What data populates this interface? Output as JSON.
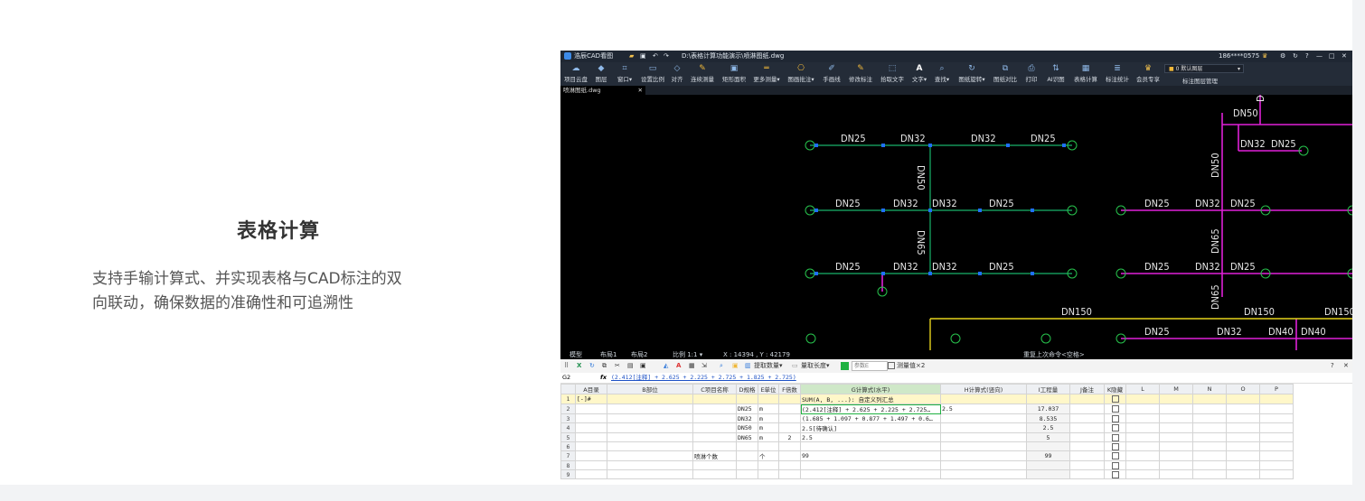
{
  "feature": {
    "title": "表格计算",
    "desc_line1": "支持手输计算式、并实现表格与CAD标注的双",
    "desc_line2": "向联动，确保数据的准确性和可追溯性"
  },
  "app": {
    "title": "浩辰CAD看图",
    "path": "D:\\表格计算功能演示\\喷淋图纸.dwg",
    "user": "186****0575",
    "window_controls": [
      "?",
      "—",
      "□",
      "✕"
    ],
    "ribbon": [
      {
        "icon": "cloud-icon",
        "label": "项目云盘"
      },
      {
        "icon": "layers-icon",
        "label": "图层"
      },
      {
        "icon": "window-icon",
        "label": "窗口▾"
      },
      {
        "icon": "scale-icon",
        "label": "设置比例"
      },
      {
        "icon": "align-icon",
        "label": "对齐"
      },
      {
        "icon": "measure-icon",
        "label": "连续测量"
      },
      {
        "icon": "area-icon",
        "label": "矩形面积"
      },
      {
        "icon": "more-measure-icon",
        "label": "更多测量▾"
      },
      {
        "icon": "annotate-icon",
        "label": "图画批注▾"
      },
      {
        "icon": "pen-icon",
        "label": "手画线"
      },
      {
        "icon": "edit-mark-icon",
        "label": "修改标注"
      },
      {
        "icon": "pick-text-icon",
        "label": "拾取文字"
      },
      {
        "icon": "text-icon",
        "label": "文字▾"
      },
      {
        "icon": "find-icon",
        "label": "查找▾"
      },
      {
        "icon": "rotate-icon",
        "label": "图纸旋转▾"
      },
      {
        "icon": "compare-icon",
        "label": "图纸对比"
      },
      {
        "icon": "print-icon",
        "label": "打印"
      },
      {
        "icon": "ai-icon",
        "label": "AI识图"
      },
      {
        "icon": "table-calc-icon",
        "label": "表格计算"
      },
      {
        "icon": "stats-icon",
        "label": "标注统计"
      },
      {
        "icon": "vip-icon",
        "label": "会员专享"
      }
    ],
    "layer_select": "0 默认图层",
    "layer_manage": "标注图层管理",
    "doc_tab": "喷淋图纸.dwg",
    "status": {
      "model_tab": "模型",
      "layout1": "布局1",
      "layout2": "布局2",
      "scale": "比例 1:1 ▾",
      "coords": "X : 14394 , Y : 42179",
      "command": "重复上次命令<空格>"
    }
  },
  "drawing": {
    "left": {
      "row1": [
        "DN25",
        "DN32",
        "DN32",
        "DN25"
      ],
      "vert1": "DN50",
      "row2": [
        "DN25",
        "DN32",
        "DN32",
        "DN25"
      ],
      "vert2": "DN65",
      "row3": [
        "DN25",
        "DN32",
        "DN32",
        "DN25"
      ]
    },
    "right": {
      "top": [
        "DN50",
        "DN32",
        "DN32",
        "DN25"
      ],
      "vert_top": "DN50",
      "row2": [
        "DN25",
        "DN32",
        "DN25"
      ],
      "vert_mid": "DN65",
      "row3": [
        "DN25",
        "DN32",
        "DN25"
      ],
      "vert_low": "DN65",
      "main_left": "DN150",
      "main_right": [
        "DN150",
        "DN150"
      ],
      "row4": [
        "DN25",
        "DN32",
        "DN40",
        "DN40"
      ]
    },
    "colors": {
      "green_pipe": "#18b36b",
      "magenta_pipe": "#e020d8",
      "yellow_pipe": "#e6d21c",
      "node": "#1f6fff",
      "sprinkler": "#27c24c",
      "label": "#e8e8e8"
    }
  },
  "sheet": {
    "toolbar": {
      "extract_count": "提取数量▾",
      "measure_length": "量取长度▾",
      "param_placeholder": "参数E",
      "measure_value": "测量值×2",
      "help": "?",
      "close": "✕"
    },
    "cell_ref": "G2",
    "formula": "(2.412[注释] + 2.625 + 2.225 + 2.725 + 1.825 + 2.725)",
    "columns": [
      "A目录",
      "B部位",
      "C项目名称",
      "D规格",
      "E单位",
      "F倍数",
      "G计算式(水平)",
      "H计算式(竖向)",
      "I工程量",
      "J备注",
      "K隐藏",
      "L",
      "M",
      "N",
      "O",
      "P"
    ],
    "rows": [
      {
        "n": "1",
        "a": "[-]#",
        "b": "",
        "c": "",
        "d": "",
        "e": "",
        "f": "",
        "g": "SUM(A, B, ...): 自定义列汇总",
        "h": "",
        "i": "",
        "j": ""
      },
      {
        "n": "2",
        "a": "",
        "b": "",
        "c": "",
        "d": "DN25",
        "e": "m",
        "f": "",
        "g": "(2.412[注释] + 2.625 + 2.225 + 2.725…",
        "h": "2.5",
        "i": "17.037",
        "j": ""
      },
      {
        "n": "3",
        "a": "",
        "b": "",
        "c": "",
        "d": "DN32",
        "e": "m",
        "f": "",
        "g": "(1.685 + 1.097 + 0.877 + 1.497 + 0.6…",
        "h": "",
        "i": "8.535",
        "j": ""
      },
      {
        "n": "4",
        "a": "",
        "b": "",
        "c": "",
        "d": "DN50",
        "e": "m",
        "f": "",
        "g": "2.5[待确认]",
        "h": "",
        "i": "2.5",
        "j": ""
      },
      {
        "n": "5",
        "a": "",
        "b": "",
        "c": "",
        "d": "DN65",
        "e": "m",
        "f": "2",
        "g": "2.5",
        "h": "",
        "i": "5",
        "j": ""
      },
      {
        "n": "6",
        "a": "",
        "b": "",
        "c": "",
        "d": "",
        "e": "",
        "f": "",
        "g": "",
        "h": "",
        "i": "",
        "j": ""
      },
      {
        "n": "7",
        "a": "",
        "b": "",
        "c": "喷淋个数",
        "d": "",
        "e": "个",
        "f": "",
        "g": "99",
        "h": "",
        "i": "99",
        "j": ""
      },
      {
        "n": "8",
        "a": "",
        "b": "",
        "c": "",
        "d": "",
        "e": "",
        "f": "",
        "g": "",
        "h": "",
        "i": "",
        "j": ""
      },
      {
        "n": "9",
        "a": "",
        "b": "",
        "c": "",
        "d": "",
        "e": "",
        "f": "",
        "g": "",
        "h": "",
        "i": "",
        "j": ""
      }
    ]
  }
}
